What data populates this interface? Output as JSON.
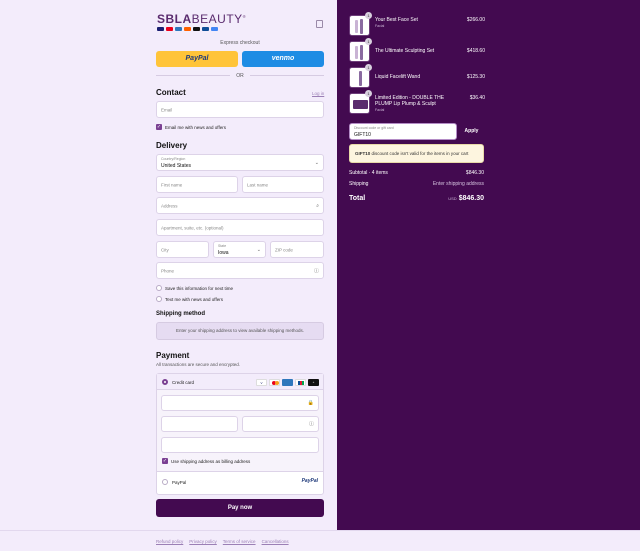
{
  "brand": {
    "name_bold": "SBLA",
    "name_light": "BEAUTY",
    "mark": "®"
  },
  "express": {
    "title": "Express checkout",
    "paypal_label": "PayPal",
    "venmo_label": "venmo",
    "or_label": "OR"
  },
  "contact": {
    "heading": "Contact",
    "login_label": "Log in",
    "email_placeholder": "Email",
    "news_label": "Email me with news and offers"
  },
  "delivery": {
    "heading": "Delivery",
    "country_label": "Country/Region",
    "country_value": "United States",
    "first_name": "First name",
    "last_name": "Last name",
    "address": "Address",
    "apartment": "Apartment, suite, etc. (optional)",
    "city": "City",
    "state_label": "State",
    "state_value": "Iowa",
    "zip": "ZIP code",
    "phone": "Phone",
    "save_info": "Save this information for next time",
    "text_me": "Text me with news and offers"
  },
  "shipping": {
    "heading": "Shipping method",
    "message": "Enter your shipping address to view available shipping methods."
  },
  "payment": {
    "heading": "Payment",
    "subtitle": "All transactions are secure and encrypted.",
    "credit_card_label": "Credit card",
    "billing_label": "Use shipping address as billing address",
    "paypal_label": "PayPal",
    "paypal_logo": "PayPal",
    "pay_now": "Pay now"
  },
  "footer": {
    "links": [
      "Refund policy",
      "Privacy policy",
      "Terms of service",
      "Cancellations"
    ]
  },
  "cart": {
    "items": [
      {
        "name": "Your Best Face Set",
        "sub": "Facial",
        "price": "$266.00",
        "qty": "1"
      },
      {
        "name": "The Ultimate Sculpting Set",
        "sub": "",
        "price": "$418.60",
        "qty": "1"
      },
      {
        "name": "Liquid Facelift Wand",
        "sub": "",
        "price": "$125.30",
        "qty": "1"
      },
      {
        "name": "Limited Edition - DOUBLE THE PLUMP Lip Plump & Sculpt",
        "sub": "Facial",
        "price": "$36.40",
        "qty": "1"
      }
    ],
    "discount_label": "Discount code or gift card",
    "discount_value": "GIFT10",
    "apply_label": "Apply",
    "warning_code": "GIFT10",
    "warning_text": "discount code isn't valid for the items in your cart",
    "subtotal_label": "Subtotal · 4 items",
    "subtotal_value": "$846.30",
    "shipping_label": "Shipping",
    "shipping_value": "Enter shipping address",
    "total_label": "Total",
    "total_currency": "USD",
    "total_value": "$846.30"
  },
  "colors": {
    "accent": "#430a50",
    "paypal_yellow": "#ffc439",
    "venmo_blue": "#1e8ce4",
    "background": "#f3ecfb"
  }
}
